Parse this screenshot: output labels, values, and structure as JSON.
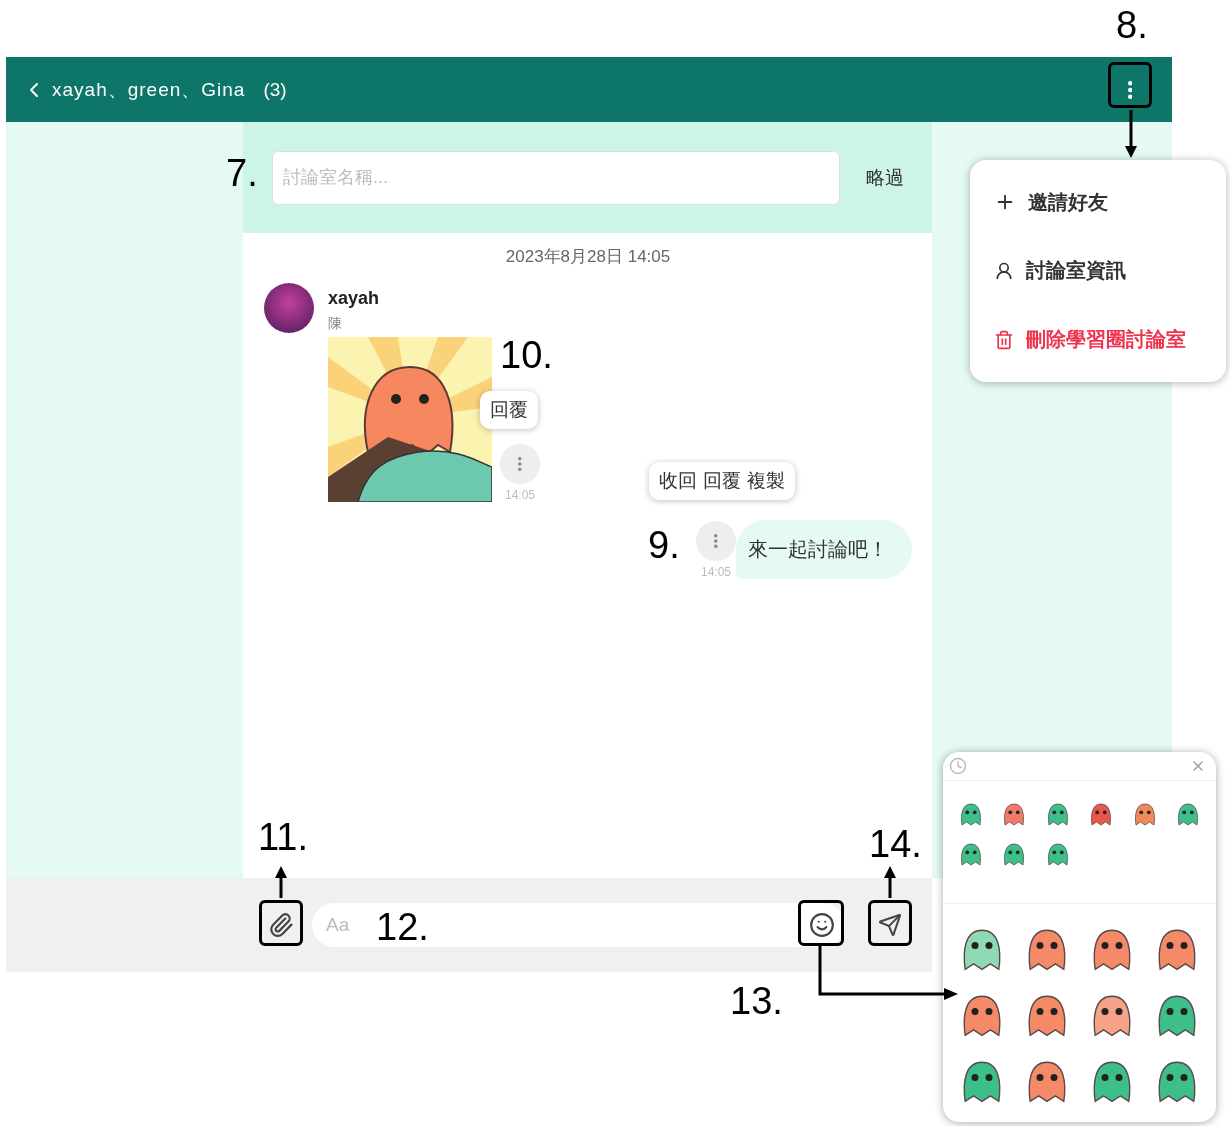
{
  "header": {
    "title": "xayah、green、Gina",
    "count": "(3)"
  },
  "room_name": {
    "placeholder": "討論室名稱...",
    "skip": "略過"
  },
  "date": "2023年8月28日 14:05",
  "messages": [
    {
      "kind": "sticker",
      "sender": "xayah",
      "subtitle": "陳",
      "time": "14:05",
      "actions": [
        "回覆"
      ]
    },
    {
      "kind": "text",
      "text": "來一起討論吧！",
      "time": "14:05",
      "actions": [
        "收回",
        "回覆",
        "複製"
      ]
    }
  ],
  "composer": {
    "placeholder": "Aa"
  },
  "menu": [
    {
      "kind": "invite",
      "label": "邀請好友"
    },
    {
      "kind": "info",
      "label": "討論室資訊"
    },
    {
      "kind": "danger",
      "label": "刪除學習圈討論室"
    }
  ],
  "sticker_panel": {
    "recent": [
      {
        "color": "#3dbf8a"
      },
      {
        "color": "#f07a6a"
      },
      {
        "color": "#3dbf8a"
      },
      {
        "color": "#e8584a"
      },
      {
        "color": "#f08a5a"
      },
      {
        "color": "#3dbf8a"
      },
      {
        "color": "#3dbf8a"
      },
      {
        "color": "#3dbf8a"
      },
      {
        "color": "#3dbf8a"
      }
    ],
    "pack": [
      {
        "color": "#8fd9b5"
      },
      {
        "color": "#f58a68"
      },
      {
        "color": "#f58a68"
      },
      {
        "color": "#f58a68"
      },
      {
        "color": "#f58a68"
      },
      {
        "color": "#f58a68"
      },
      {
        "color": "#f7a38a"
      },
      {
        "color": "#3dbf8a"
      },
      {
        "color": "#3dbf8a"
      },
      {
        "color": "#f58a68"
      },
      {
        "color": "#3dbf8a"
      },
      {
        "color": "#3dbf8a"
      }
    ]
  },
  "annotations": [
    {
      "label": "7."
    },
    {
      "label": "8."
    },
    {
      "label": "9."
    },
    {
      "label": "10."
    },
    {
      "label": "11."
    },
    {
      "label": "12."
    },
    {
      "label": "13."
    },
    {
      "label": "14."
    }
  ]
}
